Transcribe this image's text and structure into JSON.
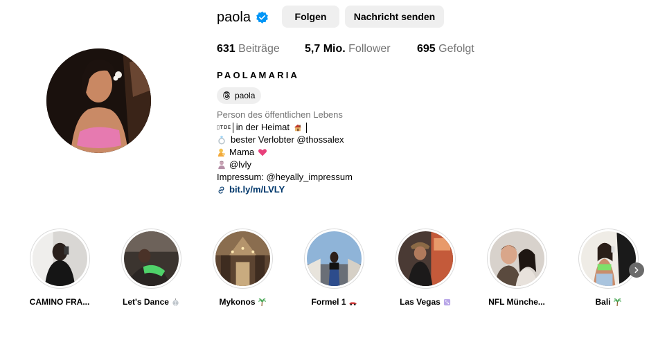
{
  "profile": {
    "username": "paola",
    "verified": true,
    "follow_label": "Folgen",
    "message_label": "Nachricht senden",
    "stats": {
      "posts_count": "631",
      "posts_label": "Beiträge",
      "followers_count": "5,7 Mio.",
      "followers_label": "Follower",
      "following_count": "695",
      "following_label": "Gefolgt"
    },
    "full_name": "PAOLAMARIA",
    "threads_handle": "paola",
    "category": "Person des öffentlichen Lebens",
    "bio_lines": [
      {
        "prefix": "ɪᴛᴅᴇ",
        "text": "in der Heimat",
        "emoji": "house-icon"
      },
      {
        "text": "bester Verlobter @thossalex",
        "emoji": "ring-icon"
      },
      {
        "text": "Mama",
        "emoji": "mother-icon",
        "suffix_emoji": "heart-icon"
      },
      {
        "text": "@lvly",
        "emoji": "person-icon"
      }
    ],
    "impressum": "Impressum: @heyally_impressum",
    "link": "bit.ly/m/LVLY"
  },
  "highlights": [
    {
      "label": "CAMINO FRA...",
      "emoji": ""
    },
    {
      "label": "Let's Dance",
      "emoji": "disco-ball-icon"
    },
    {
      "label": "Mykonos",
      "emoji": "palm-icon"
    },
    {
      "label": "Formel 1",
      "emoji": "race-car-icon"
    },
    {
      "label": "Las Vegas",
      "emoji": "dice-icon"
    },
    {
      "label": "NFL Münche...",
      "emoji": ""
    },
    {
      "label": "Bali",
      "emoji": "palm-icon"
    }
  ],
  "colors": {
    "verified_blue": "#0095f6",
    "button_bg": "#efefef",
    "muted_text": "#737373",
    "link_blue": "#00376b"
  }
}
